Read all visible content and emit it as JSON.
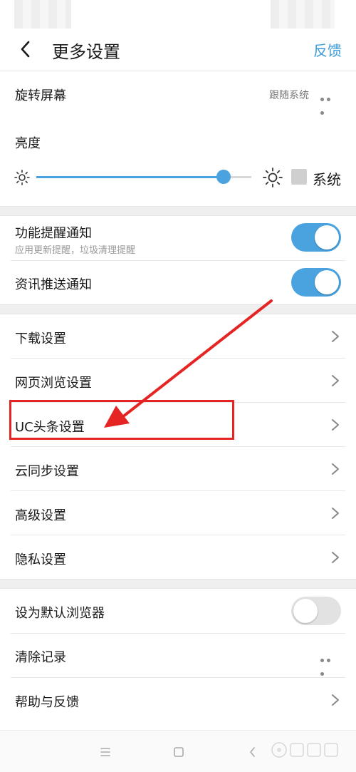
{
  "header": {
    "title": "更多设置",
    "feedback_label": "反馈"
  },
  "rotate": {
    "label": "旋转屏幕",
    "value": "跟随系统"
  },
  "brightness": {
    "label": "亮度",
    "level": 0.87,
    "system_label": "系统",
    "system_checked": false
  },
  "notifications": {
    "feature": {
      "label": "功能提醒通知",
      "sub": "应用更新提醒，垃圾清理提醒",
      "on": true
    },
    "news": {
      "label": "资讯推送通知",
      "on": true
    }
  },
  "menu": {
    "download": "下载设置",
    "web_browse": "网页浏览设置",
    "uc_headlines": "UC头条设置",
    "cloud_sync": "云同步设置",
    "advanced": "高级设置",
    "privacy": "隐私设置"
  },
  "bottom": {
    "default_browser": {
      "label": "设为默认浏览器",
      "on": false
    },
    "clear_history": "清除记录",
    "help_feedback": "帮助与反馈"
  },
  "colors": {
    "accent": "#4aa3df",
    "highlight": "#e52424"
  },
  "icons": [
    "back-arrow-icon",
    "more-dots-icon",
    "sun-small-icon",
    "sun-large-icon",
    "chevron-right-icon",
    "menu-icon",
    "home-icon",
    "back-icon"
  ]
}
